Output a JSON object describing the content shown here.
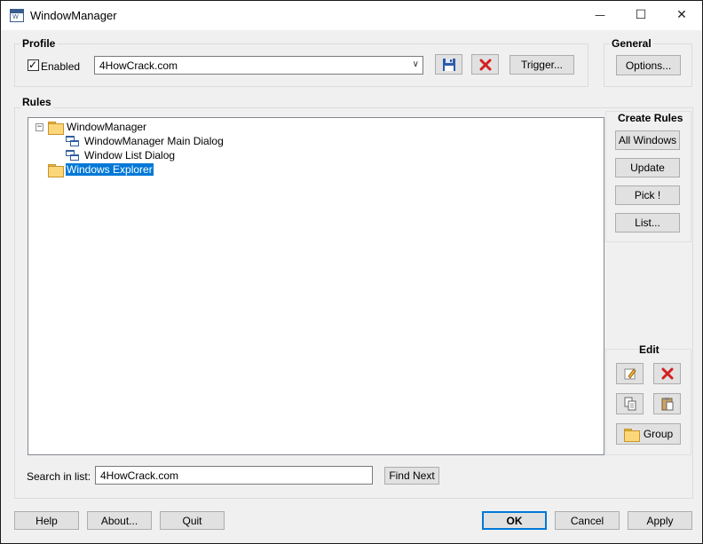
{
  "window": {
    "title": "WindowManager",
    "icon": "wm-app-icon",
    "minimize_glyph": "—",
    "maximize_glyph": "☐",
    "close_glyph": "✕"
  },
  "profile": {
    "group_title": "Profile",
    "enabled_label": "Enabled",
    "enabled_checked": true,
    "check_glyph": "✓",
    "selected_profile": "4HowCrack.com",
    "trigger_label": "Trigger...",
    "save_icon": "floppy-disk-icon",
    "delete_icon": "red-x-icon"
  },
  "general": {
    "group_title": "General",
    "options_label": "Options..."
  },
  "rules": {
    "group_title": "Rules",
    "tree": [
      {
        "label": "WindowManager",
        "type": "folder",
        "expanded": true,
        "collapse_glyph": "−"
      },
      {
        "label": "WindowManager Main Dialog",
        "type": "window"
      },
      {
        "label": "Window List Dialog",
        "type": "window"
      },
      {
        "label": "Windows Explorer",
        "type": "folder",
        "selected": true
      }
    ]
  },
  "create_rules": {
    "title": "Create Rules",
    "all_windows_label": "All Windows",
    "update_label": "Update",
    "pick_label": "Pick !",
    "list_label": "List..."
  },
  "edit": {
    "title": "Edit",
    "group_label": "Group",
    "icons": [
      "edit-pencil-icon",
      "delete-x-icon",
      "copy-icon",
      "paste-icon",
      "folder-icon"
    ]
  },
  "search": {
    "label": "Search in list:",
    "value": "4HowCrack.com",
    "find_next_label": "Find Next"
  },
  "footer": {
    "help_label": "Help",
    "about_label": "About...",
    "quit_label": "Quit",
    "ok_label": "OK",
    "cancel_label": "Cancel",
    "apply_label": "Apply"
  },
  "colors": {
    "selection": "#0078d7",
    "delete_red": "#d41f1f",
    "folder_yellow": "#fcd77a",
    "save_blue": "#2a5caa"
  }
}
